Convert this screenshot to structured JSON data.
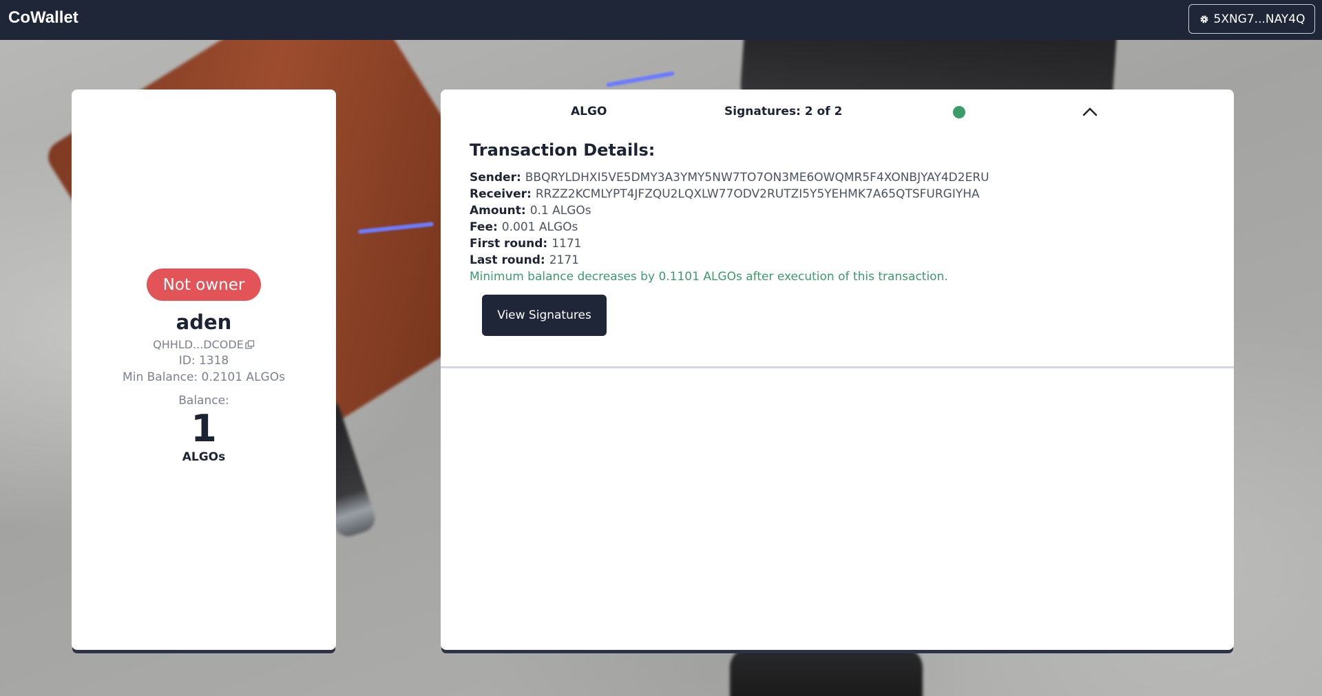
{
  "app": {
    "brand": "CoWallet"
  },
  "header": {
    "wallet_address": "5XNG7...NAY4Q",
    "wallet_icon": "gear-icon"
  },
  "account": {
    "owner_badge": "Not owner",
    "name": "aden",
    "address": "QHHLD...DCODE",
    "id": "ID: 1318",
    "min_balance": "Min Balance: 0.2101 ALGOs",
    "balance_label": "Balance:",
    "balance": "1",
    "balance_unit": "ALGOs"
  },
  "transaction": {
    "asset": "ALGO",
    "signatures": "Signatures: 2 of 2",
    "status_color": "#3a9d68",
    "title": "Transaction Details:",
    "details": [
      {
        "key": "Sender:",
        "value": "BBQRYLDHXI5VE5DMY3A3YMY5NW7TO7ON3ME6OWQMR5F4XONBJYAY4D2ERU"
      },
      {
        "key": "Receiver:",
        "value": "RRZZ2KCMLYPT4JFZQU2LQXLW77ODV2RUTZI5Y5YEHMK7A65QTSFURGIYHA"
      },
      {
        "key": "Amount:",
        "value": "0.1 ALGOs"
      },
      {
        "key": "Fee:",
        "value": "0.001 ALGOs"
      },
      {
        "key": "First round:",
        "value": "1171"
      },
      {
        "key": "Last round:",
        "value": "2171"
      }
    ],
    "note": "Minimum balance decreases by 0.1101 ALGOs after execution of this transaction.",
    "view_signatures_label": "View Signatures"
  },
  "colors": {
    "topbar": "#1f2638",
    "badge": "#e25457",
    "button": "#1f2638",
    "note": "#3a9d68"
  }
}
